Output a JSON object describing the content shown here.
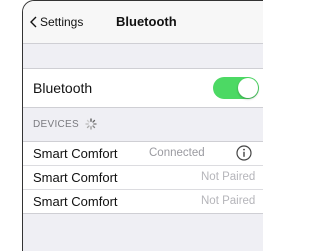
{
  "nav": {
    "back_label": "Settings",
    "title": "Bluetooth"
  },
  "bluetooth_row": {
    "label": "Bluetooth",
    "toggle_on": true,
    "toggle_color": "#4cd964"
  },
  "devices_section": {
    "header": "DEVICES",
    "loading_icon": "spinner-icon",
    "items": [
      {
        "name": "Smart Comfort",
        "status": "Connected",
        "info_icon": "info-icon"
      },
      {
        "name": "Smart Comfort",
        "status": "Not Paired"
      },
      {
        "name": "Smart Comfort",
        "status": "Not Paired"
      }
    ]
  }
}
